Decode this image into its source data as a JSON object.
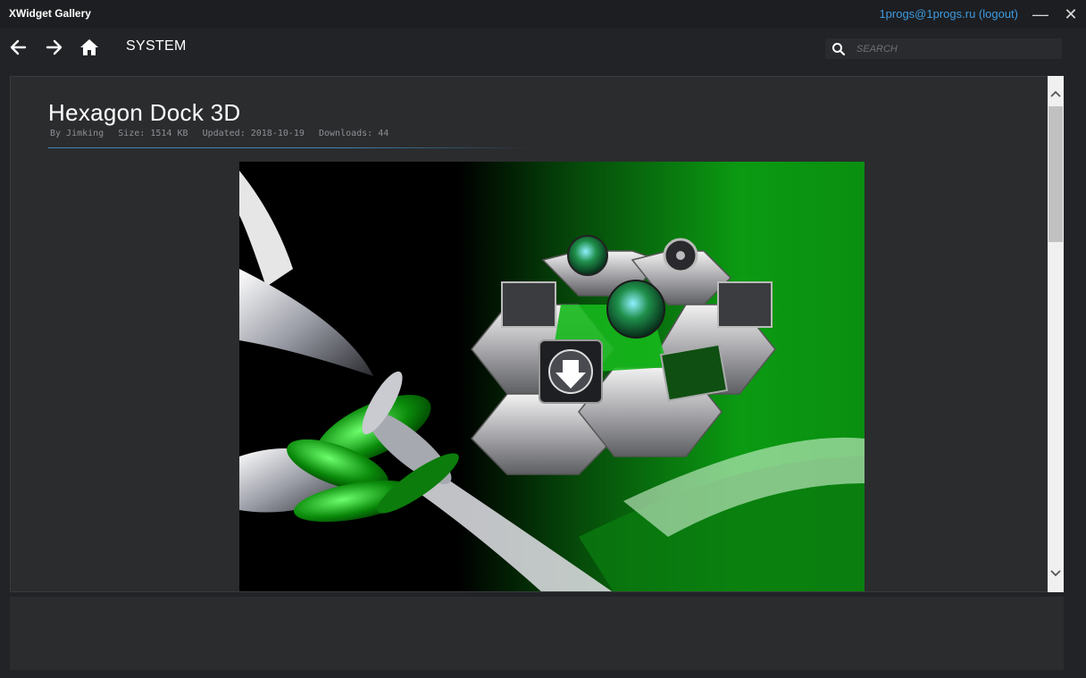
{
  "app": {
    "title": "XWidget Gallery",
    "account_label": "1progs@1progs.ru (logout)"
  },
  "window_controls": {
    "minimize": "—",
    "close": "✕"
  },
  "toolbar": {
    "back_icon": "arrow-left-icon",
    "forward_icon": "arrow-right-icon",
    "home_icon": "home-icon",
    "section": "SYSTEM",
    "search_placeholder": "SEARCH",
    "search_value": ""
  },
  "widget": {
    "title": "Hexagon Dock 3D",
    "author": "By Jimking",
    "size": "Size: 1514 KB",
    "updated": "Updated: 2018-10-19",
    "downloads": "Downloads: 44"
  },
  "colors": {
    "accent_link": "#3d9be0",
    "rule": "#3e86b8",
    "preview_green": "#0a9a12"
  }
}
